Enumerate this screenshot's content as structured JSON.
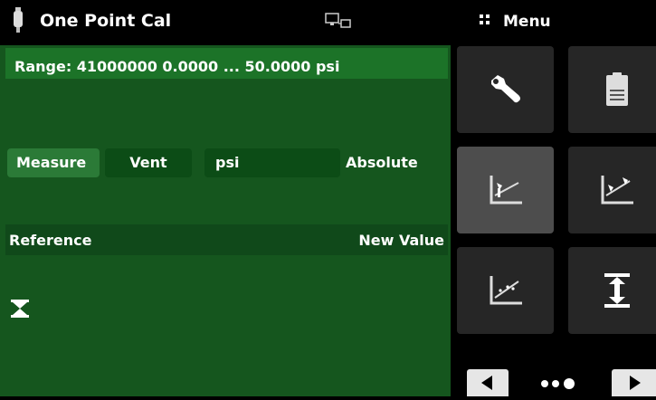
{
  "header": {
    "title": "One Point Cal",
    "menu_label": "Menu",
    "icons": {
      "device": "pressure-device-icon",
      "remote": "remote-connection-icon",
      "menu": "menu-grid-icon"
    }
  },
  "range": {
    "text": "Range: 41000000  0.0000 ... 50.0000 psi"
  },
  "controls": {
    "measure_label": "Measure",
    "vent_label": "Vent",
    "unit_label": "psi",
    "mode_label": "Absolute"
  },
  "table": {
    "reference_label": "Reference",
    "new_value_label": "New Value"
  },
  "tiles": [
    {
      "name": "settings-wrench-tile",
      "icon": "wrench-icon",
      "active": false
    },
    {
      "name": "document-tile",
      "icon": "document-icon",
      "active": false
    },
    {
      "name": "one-point-cal-tile",
      "icon": "one-point-cal-icon",
      "active": true
    },
    {
      "name": "two-point-cal-tile",
      "icon": "two-point-cal-icon",
      "active": false
    },
    {
      "name": "linearization-tile",
      "icon": "linearization-icon",
      "active": false
    },
    {
      "name": "zero-adjust-tile",
      "icon": "zero-adjust-icon",
      "active": false
    }
  ],
  "nav": {
    "prev": "left-arrow-icon",
    "next": "right-arrow-icon",
    "pages": "page-dots-icon"
  },
  "colors": {
    "panel": "#15561e",
    "header_bg": "#000000",
    "tile_bg": "#262626",
    "tile_active": "#4d4d4d"
  }
}
